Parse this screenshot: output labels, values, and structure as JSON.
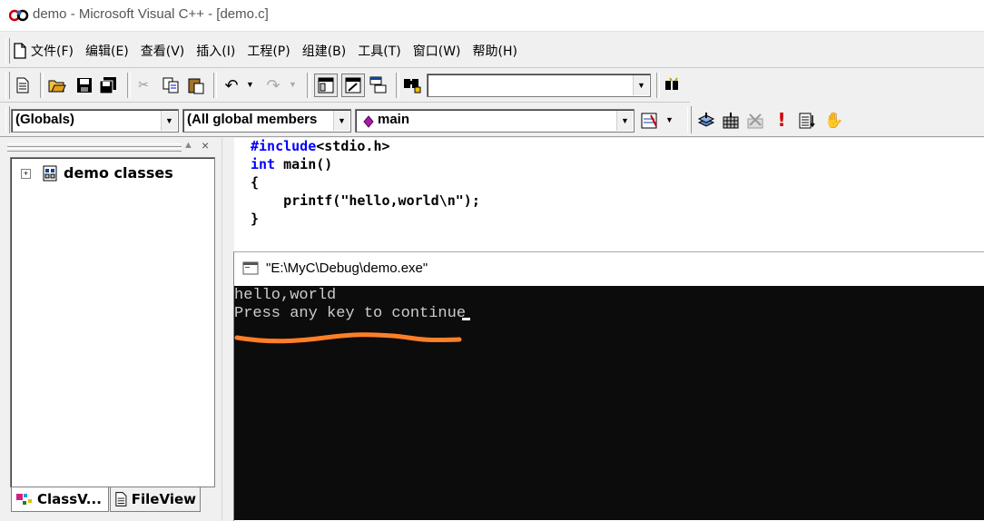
{
  "window": {
    "title": "demo - Microsoft Visual C++ - [demo.c]"
  },
  "menu": {
    "items": [
      "文件(F)",
      "编辑(E)",
      "查看(V)",
      "插入(I)",
      "工程(P)",
      "组建(B)",
      "工具(T)",
      "窗口(W)",
      "帮助(H)"
    ]
  },
  "toolbar": {
    "find_value": ""
  },
  "wizard_bar": {
    "class_combo": "(Globals)",
    "filter_combo": "(All global members",
    "member_combo": "main"
  },
  "workspace": {
    "tree_root": "demo classes",
    "tabs": [
      "ClassV...",
      "FileView"
    ]
  },
  "editor": {
    "lines": [
      "#include<stdio.h>",
      "int main()",
      "{",
      "    printf(\"hello,world\\n\");",
      "}"
    ],
    "kw_include": "#include",
    "inc_rest": "<stdio.h>",
    "kw_int": "int",
    "int_rest": " main()"
  },
  "console": {
    "title": "\"E:\\MyC\\Debug\\demo.exe\"",
    "lines": [
      "hello,world",
      "Press any key to continue"
    ]
  },
  "colors": {
    "annotation": "#ff7f27",
    "console_bg": "#0c0c0c",
    "console_text": "#cccccc",
    "keyword": "#0000ff"
  }
}
